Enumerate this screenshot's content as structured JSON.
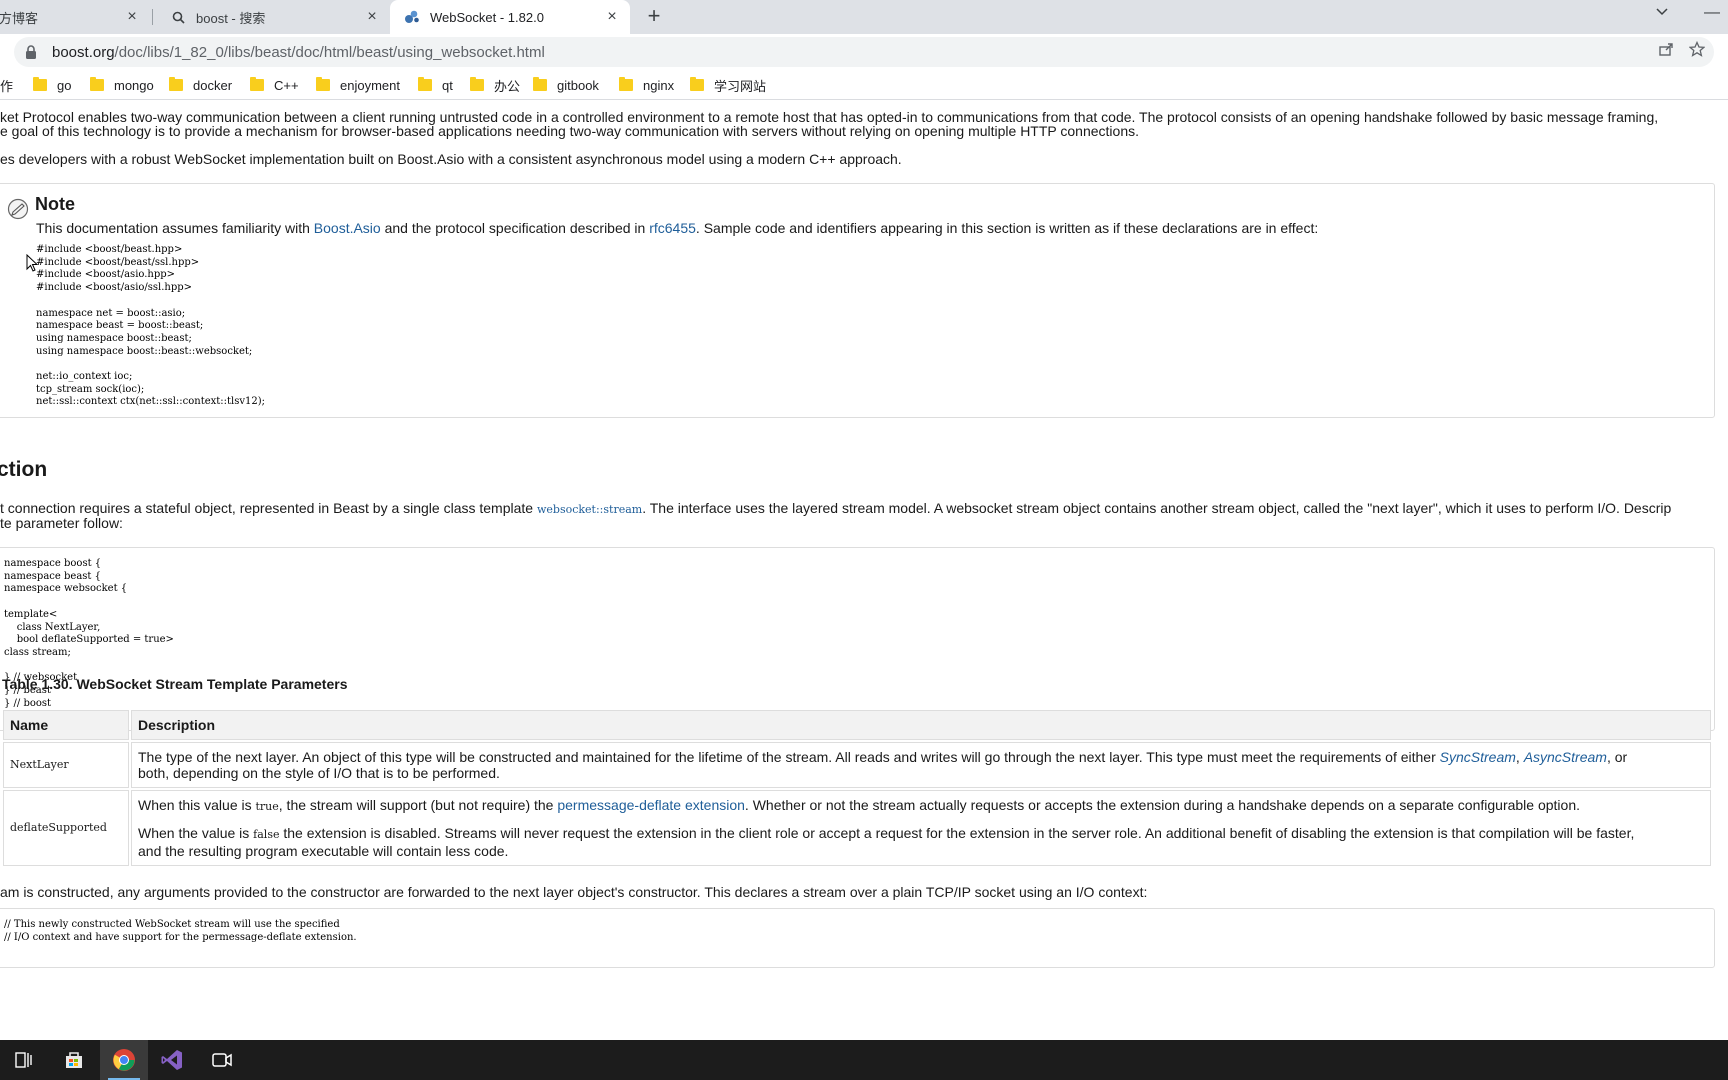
{
  "browser": {
    "tabs": [
      {
        "label": "官方博客"
      },
      {
        "label": "boost - 搜索"
      },
      {
        "label": "WebSocket - 1.82.0"
      }
    ],
    "url_host": "boost.org",
    "url_path": "/doc/libs/1_82_0/libs/beast/doc/html/beast/using_websocket.html",
    "bookmarks": [
      {
        "label": "工作"
      },
      {
        "label": "go"
      },
      {
        "label": "mongo"
      },
      {
        "label": "docker"
      },
      {
        "label": "C++"
      },
      {
        "label": "enjoyment"
      },
      {
        "label": "qt"
      },
      {
        "label": "办公"
      },
      {
        "label": "gitbook"
      },
      {
        "label": "nginx"
      },
      {
        "label": "学习网站"
      }
    ]
  },
  "content": {
    "intro1": "ket Protocol enables two-way communication between a client running untrusted code in a controlled environment to a remote host that has opted-in to communications from that code. The protocol consists of an opening handshake followed by basic message framing,",
    "intro2": "e goal of this technology is to provide a mechanism for browser-based applications needing two-way communication with servers without relying on opening multiple HTTP connections.",
    "intro3": "es developers with a robust WebSocket implementation built on Boost.Asio with a consistent asynchronous model using a modern C++ approach.",
    "note": {
      "title": "Note",
      "text_a": "This documentation assumes familiarity with ",
      "link_asio": "Boost.Asio",
      "text_b": " and the protocol specification described in ",
      "link_rfc": "rfc6455",
      "text_c": ". Sample code and identifiers appearing in this section is written as if these declarations are in effect:",
      "code": "#include <boost/beast.hpp>\n#include <boost/beast/ssl.hpp>\n#include <boost/asio.hpp>\n#include <boost/asio/ssl.hpp>\n\nnamespace net = boost::asio;\nnamespace beast = boost::beast;\nusing namespace boost::beast;\nusing namespace boost::beast::websocket;\n\nnet::io_context ioc;\ntcp_stream sock(ioc);\nnet::ssl::context ctx(net::ssl::context::tlsv12);"
    },
    "section_title": "ction",
    "section_para_a": "t connection requires a stateful object, represented in Beast by a single class template ",
    "section_para_code": "websocket::stream",
    "section_para_b": ". The interface uses the layered stream model. A websocket stream object contains another stream object, called the \"next layer\", which it uses to perform I/O. Descrip",
    "section_para2": "te parameter follow:",
    "template_code": "namespace boost {\nnamespace beast {\nnamespace websocket {\n\ntemplate<\n    class NextLayer,\n    bool deflateSupported = true>\nclass stream;\n\n} // websocket\n} // beast\n} // boost",
    "table": {
      "caption": "Table 1.30. WebSocket Stream Template Parameters",
      "col_name": "Name",
      "col_desc": "Description",
      "row1_name": "NextLayer",
      "row1_a": "The type of the next layer. An object of this type will be constructed and maintained for the lifetime of the stream. All reads and writes will go through the next layer. This type must meet the requirements of either ",
      "row1_link1": "SyncStream",
      "row1_comma": ", ",
      "row1_link2": "AsyncStream",
      "row1_b": ", or",
      "row1_c": "both, depending on the style of I/O that is to be performed.",
      "row2_name": "deflateSupported",
      "row2_p1_a": "When this value is ",
      "row2_p1_code": "true",
      "row2_p1_b": ", the stream will support (but not require) the ",
      "row2_p1_link": "permessage-deflate extension",
      "row2_p1_c": ". Whether or not the stream actually requests or accepts the extension during a handshake depends on a separate configurable option.",
      "row2_p2_a": "When the value is ",
      "row2_p2_code": "false",
      "row2_p2_b": " the extension is disabled. Streams will never request the extension in the client role or accept a request for the extension in the server role. An additional benefit of disabling the extension is that compilation will be faster,",
      "row2_p2_c": "and the resulting program executable will contain less code."
    },
    "bottom_para": "am is constructed, any arguments provided to the constructor are forwarded to the next layer object's constructor. This declares a stream over a plain TCP/IP socket using an I/O context:",
    "bottom_code": "// This newly constructed WebSocket stream will use the specified\n// I/O context and have support for the permessage-deflate extension."
  },
  "taskbar": {
    "items": [
      {
        "icon": "task-view-icon"
      },
      {
        "icon": "store-icon"
      },
      {
        "icon": "chrome-icon"
      },
      {
        "icon": "visual-studio-icon"
      },
      {
        "icon": "camera-app-icon"
      }
    ]
  }
}
